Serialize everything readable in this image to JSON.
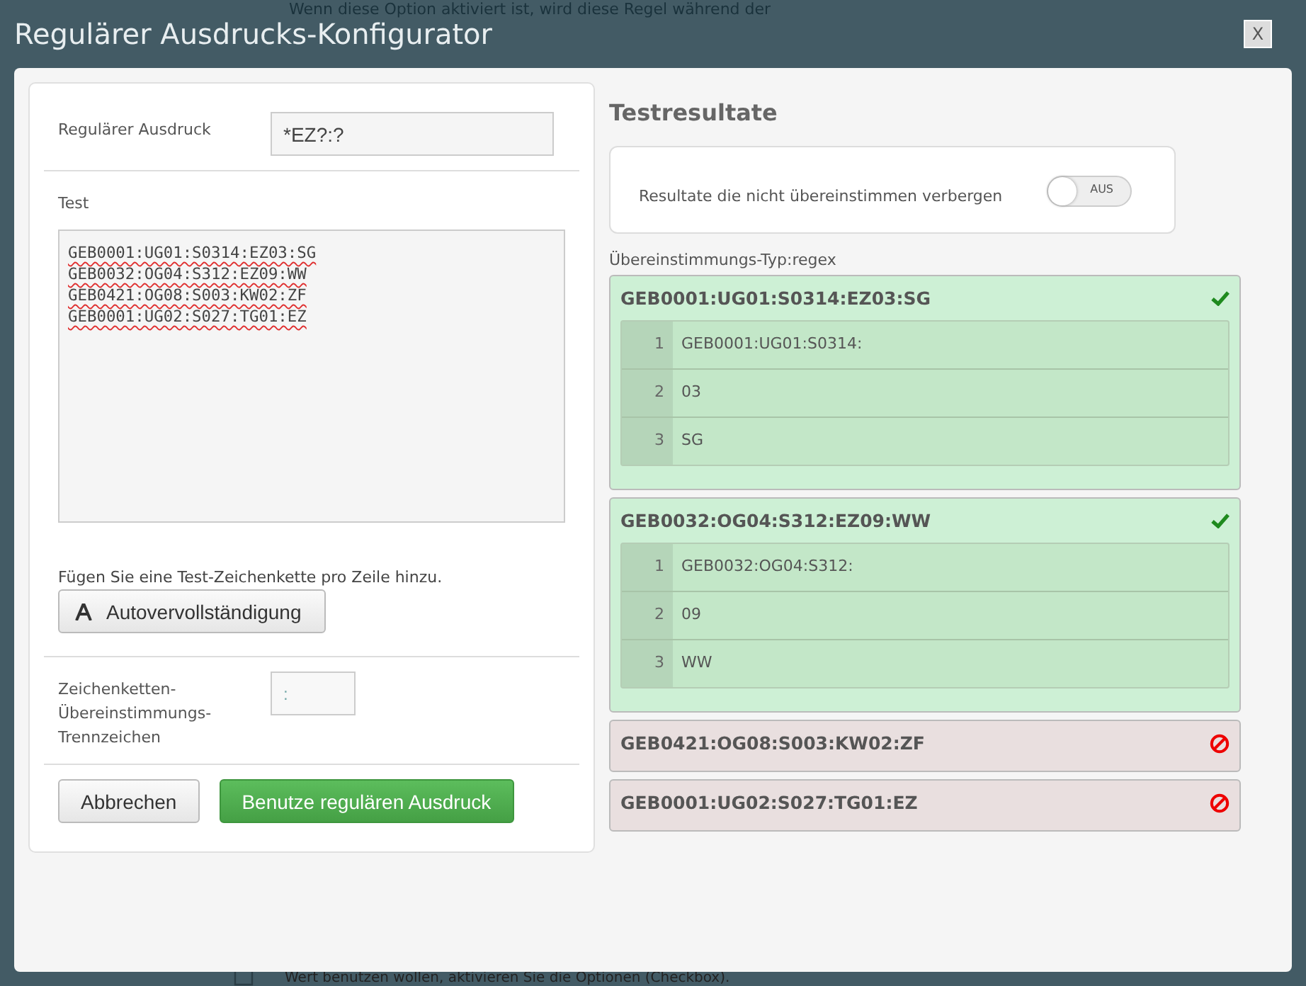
{
  "background": {
    "top_text": "Wenn diese Option aktiviert ist, wird diese Regel während der",
    "bottom_text": "Wert benutzen wollen, aktivieren Sie die Optionen (Checkbox)."
  },
  "window": {
    "title": "Regulärer Ausdrucks-Konfigurator",
    "close": "X"
  },
  "regex": {
    "label": "Regulärer Ausdruck",
    "value": "*EZ?:?"
  },
  "test": {
    "label": "Test",
    "lines": [
      "GEB0001:UG01:S0314:EZ03:SG",
      "GEB0032:OG04:S312:EZ09:WW",
      "GEB0421:OG08:S003:KW02:ZF",
      "GEB0001:UG02:S027:TG01:EZ"
    ],
    "hint": "Fügen Sie eine Test-Zeichenkette pro Zeile hinzu.",
    "autocomplete_button": "Autovervollständigung"
  },
  "separator": {
    "label": "Zeichenketten-Übereinstimmungs-Trennzeichen",
    "value": ":"
  },
  "buttons": [
    {
      "label": "Abbrechen",
      "kind": "default"
    },
    {
      "label": "Benutze regulären Ausdruck",
      "kind": "primary"
    }
  ],
  "results": {
    "title": "Testresultate",
    "hide_label": "Resultate die nicht übereinstimmen verbergen",
    "hide_toggle": {
      "on": false,
      "label": "AUS"
    },
    "match_type": "Übereinstimmungs-Typ:regex",
    "items": [
      {
        "text": "GEB0001:UG01:S0314:EZ03:SG",
        "matched": true,
        "groups": [
          {
            "index": "1",
            "value": "GEB0001:UG01:S0314:"
          },
          {
            "index": "2",
            "value": "03"
          },
          {
            "index": "3",
            "value": "SG"
          }
        ]
      },
      {
        "text": "GEB0032:OG04:S312:EZ09:WW",
        "matched": true,
        "groups": [
          {
            "index": "1",
            "value": "GEB0032:OG04:S312:"
          },
          {
            "index": "2",
            "value": "09"
          },
          {
            "index": "3",
            "value": "WW"
          }
        ]
      },
      {
        "text": "GEB0421:OG08:S003:KW02:ZF",
        "matched": false
      },
      {
        "text": "GEB0001:UG02:S027:TG01:EZ",
        "matched": false
      }
    ]
  }
}
